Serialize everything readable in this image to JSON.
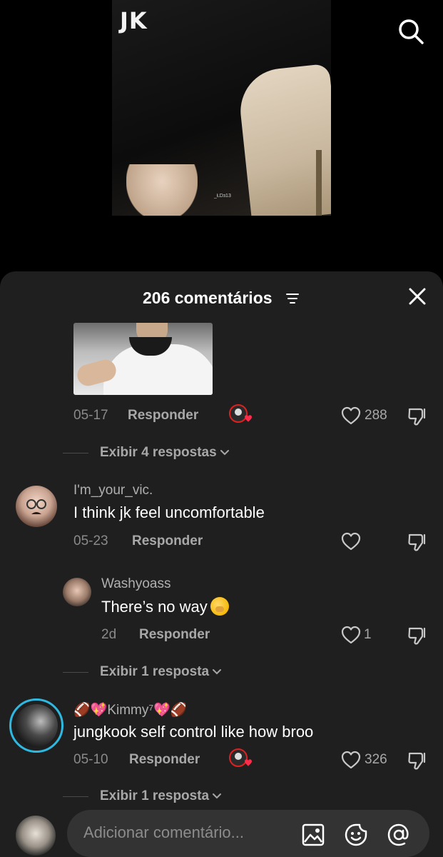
{
  "video": {
    "label": "JK",
    "watermark": "_ŁDɜ13"
  },
  "sheet": {
    "title": "206 comentários"
  },
  "comments": [
    {
      "date": "05-17",
      "reply_label": "Responder",
      "likes": "288",
      "view_replies": "Exibir 4 respostas"
    },
    {
      "username": "I'm_your_vic.",
      "text": "I think jk feel uncomfortable",
      "date": "05-23",
      "reply_label": "Responder"
    },
    {
      "username": "Washyoass",
      "text": "There’s no way",
      "date": "2d",
      "reply_label": "Responder",
      "likes": "1",
      "view_replies": "Exibir 1 resposta"
    },
    {
      "username": "🏈💖Kimmy⁷💖🏈",
      "text": "jungkook self control like how broo",
      "date": "05-10",
      "reply_label": "Responder",
      "likes": "326",
      "view_replies": "Exibir 1 resposta"
    }
  ],
  "input": {
    "placeholder": "Adicionar comentário..."
  },
  "icons": {
    "search": "search-icon",
    "filter": "filter-icon",
    "close": "close-icon",
    "like": "heart-outline-icon",
    "dislike": "thumbs-down-icon",
    "creator_liked": "creator-liked-badge",
    "image": "image-icon",
    "emoji": "emoji-icon",
    "mention": "at-icon"
  },
  "colors": {
    "sheet_bg": "#1f1f1f",
    "input_bg": "#333333",
    "muted_text": "#a8a8a8",
    "story_ring": "#2fb9e0"
  }
}
